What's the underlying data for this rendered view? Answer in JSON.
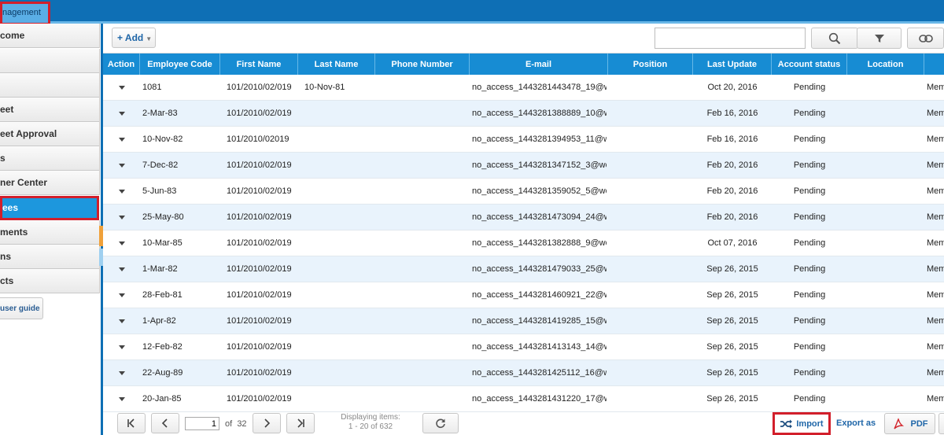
{
  "top_tab": {
    "label": "nagement"
  },
  "sidebar": {
    "items": [
      {
        "label": "come"
      },
      {
        "label": ""
      },
      {
        "label": ""
      },
      {
        "label": "eet"
      },
      {
        "label": "eet Approval"
      },
      {
        "label": "s"
      },
      {
        "label": "ner Center"
      },
      {
        "label": "ees",
        "active": true
      },
      {
        "label": "ments"
      },
      {
        "label": "ns"
      },
      {
        "label": "cts"
      }
    ],
    "guide_label": "user guide"
  },
  "toolbar": {
    "add_label": "+ Add",
    "search_value": ""
  },
  "columns": [
    "Action",
    "Employee Code",
    "First Name",
    "Last Name",
    "Phone Number",
    "E-mail",
    "Position",
    "Last Update",
    "Account status",
    "Location"
  ],
  "rows": [
    {
      "code": "1081",
      "first": "101/2010/02/019",
      "last": "10-Nov-81",
      "phone": "",
      "email": "no_access_1443281443478_19@w",
      "position": "",
      "updated": "Oct 20, 2016",
      "status": "Pending",
      "location": "",
      "extra": "Mem"
    },
    {
      "code": "2-Mar-83",
      "first": "101/2010/02/019",
      "last": "",
      "phone": "",
      "email": "no_access_1443281388889_10@w",
      "position": "",
      "updated": "Feb 16, 2016",
      "status": "Pending",
      "location": "",
      "extra": "Mem"
    },
    {
      "code": "10-Nov-82",
      "first": "101/2010/02019",
      "last": "",
      "phone": "",
      "email": "no_access_1443281394953_11@w",
      "position": "",
      "updated": "Feb 16, 2016",
      "status": "Pending",
      "location": "",
      "extra": "Mem"
    },
    {
      "code": "7-Dec-82",
      "first": "101/2010/02/019",
      "last": "",
      "phone": "",
      "email": "no_access_1443281347152_3@wo",
      "position": "",
      "updated": "Feb 20, 2016",
      "status": "Pending",
      "location": "",
      "extra": "Mem"
    },
    {
      "code": "5-Jun-83",
      "first": "101/2010/02/019",
      "last": "",
      "phone": "",
      "email": "no_access_1443281359052_5@wo",
      "position": "",
      "updated": "Feb 20, 2016",
      "status": "Pending",
      "location": "",
      "extra": "Mem"
    },
    {
      "code": "25-May-80",
      "first": "101/2010/02/019",
      "last": "",
      "phone": "",
      "email": "no_access_1443281473094_24@w",
      "position": "",
      "updated": "Feb 20, 2016",
      "status": "Pending",
      "location": "",
      "extra": "Mem"
    },
    {
      "code": "10-Mar-85",
      "first": "101/2010/02/019",
      "last": "",
      "phone": "",
      "email": "no_access_1443281382888_9@wo",
      "position": "",
      "updated": "Oct 07, 2016",
      "status": "Pending",
      "location": "",
      "extra": "Mem"
    },
    {
      "code": "1-Mar-82",
      "first": "101/2010/02/019",
      "last": "",
      "phone": "",
      "email": "no_access_1443281479033_25@w",
      "position": "",
      "updated": "Sep 26, 2015",
      "status": "Pending",
      "location": "",
      "extra": "Mem"
    },
    {
      "code": "28-Feb-81",
      "first": "101/2010/02/019",
      "last": "",
      "phone": "",
      "email": "no_access_1443281460921_22@w",
      "position": "",
      "updated": "Sep 26, 2015",
      "status": "Pending",
      "location": "",
      "extra": "Mem"
    },
    {
      "code": "1-Apr-82",
      "first": "101/2010/02/019",
      "last": "",
      "phone": "",
      "email": "no_access_1443281419285_15@w",
      "position": "",
      "updated": "Sep 26, 2015",
      "status": "Pending",
      "location": "",
      "extra": "Mem"
    },
    {
      "code": "12-Feb-82",
      "first": "101/2010/02/019",
      "last": "",
      "phone": "",
      "email": "no_access_1443281413143_14@w",
      "position": "",
      "updated": "Sep 26, 2015",
      "status": "Pending",
      "location": "",
      "extra": "Mem"
    },
    {
      "code": "22-Aug-89",
      "first": "101/2010/02/019",
      "last": "",
      "phone": "",
      "email": "no_access_1443281425112_16@w",
      "position": "",
      "updated": "Sep 26, 2015",
      "status": "Pending",
      "location": "",
      "extra": "Mem"
    },
    {
      "code": "20-Jan-85",
      "first": "101/2010/02/019",
      "last": "",
      "phone": "",
      "email": "no_access_1443281431220_17@w",
      "position": "",
      "updated": "Sep 26, 2015",
      "status": "Pending",
      "location": "",
      "extra": "Mem"
    }
  ],
  "pager": {
    "page_value": "1",
    "of_label": "of",
    "total_pages": "32",
    "display_line1": "Displaying items:",
    "display_line2": "1 - 20 of 632"
  },
  "actions": {
    "import_label": "Import",
    "export_label": "Export as",
    "pdf_label": "PDF"
  },
  "colors": {
    "top_bar": "#0e6fb5",
    "header": "#178cd3",
    "active_item": "#1d97dd",
    "highlight_border": "#d21f2b",
    "link": "#1f66a8"
  }
}
